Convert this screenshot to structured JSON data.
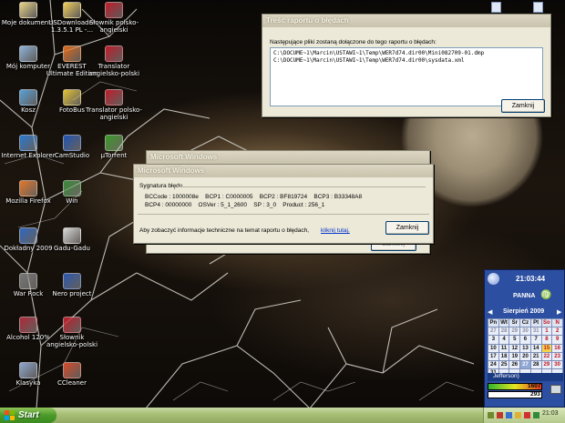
{
  "desktop_icons": [
    {
      "label": "Moje dokumenty",
      "icon": "my-documents-icon",
      "color": "#e8d48a"
    },
    {
      "label": "USDownloader 1.3.5.1 PL -...",
      "icon": "folder-icon",
      "color": "#f2cf5b"
    },
    {
      "label": "Słownik polsko-angielski",
      "icon": "dictionary-icon",
      "color": "#c01d2b"
    },
    {
      "label": "Mój komputer",
      "icon": "my-computer-icon",
      "color": "#8fb3d9"
    },
    {
      "label": "EVEREST Ultimate Edition",
      "icon": "everest-icon",
      "color": "#e06a1a"
    },
    {
      "label": "Translator angielsko-polski",
      "icon": "translator-icon",
      "color": "#c01d2b"
    },
    {
      "label": "Kosz",
      "icon": "recycle-bin-icon",
      "color": "#5aa2d8"
    },
    {
      "label": "FotoBus",
      "icon": "fotobus-icon",
      "color": "#e2c235"
    },
    {
      "label": "Translator polsko-angielski",
      "icon": "translator-icon",
      "color": "#c01d2b"
    },
    {
      "label": "Internet Explorer",
      "icon": "internet-explorer-icon",
      "color": "#2b78d0"
    },
    {
      "label": "CamStudio",
      "icon": "camstudio-icon",
      "color": "#2154b4"
    },
    {
      "label": "µTorrent",
      "icon": "utorrent-icon",
      "color": "#3a9b28"
    },
    {
      "label": "Mozilla Firefox",
      "icon": "firefox-icon",
      "color": "#e5772a"
    },
    {
      "label": "Win",
      "icon": "windows-shield-icon",
      "color": "#3b8b3a"
    },
    {
      "label": "Dokładny 2009",
      "icon": "app-icon",
      "color": "#2f68c2"
    },
    {
      "label": "Gadu-Gadu",
      "icon": "gadu-gadu-icon",
      "color": "#d8d8d8"
    },
    {
      "label": "War Rock",
      "icon": "war-rock-icon",
      "color": "#777777"
    },
    {
      "label": "Nero project",
      "icon": "nero-icon",
      "color": "#2c58b0"
    },
    {
      "label": "Alcohol 120%",
      "icon": "alcohol-icon",
      "color": "#b02a3a"
    },
    {
      "label": "Słownik angielsko-polski",
      "icon": "dictionary-icon",
      "color": "#c01d2b"
    },
    {
      "label": "Klasyka",
      "icon": "document-icon",
      "color": "#8fa7cf"
    },
    {
      "label": "CCleaner",
      "icon": "ccleaner-icon",
      "color": "#d84b2a"
    }
  ],
  "report_window": {
    "title": "Treść raportu o błędach",
    "intro": "Następujące pliki zostaną dołączone do tego raportu o błędach:",
    "files": [
      "C:\\DOCUME~1\\Marcin\\USTAWI~1\\Temp\\WER7d74.dir00\\Mini082709-01.dmp",
      "C:\\DOCUME~1\\Marcin\\USTAWI~1\\Temp\\WER7d74.dir00\\sysdata.xml"
    ],
    "close_label": "Zamknij"
  },
  "back_window": {
    "title": "Microsoft Windows",
    "close_label": "Zamknij"
  },
  "signature_window": {
    "title": "Microsoft Windows",
    "section_label": "Sygnatura błędu",
    "line1": "BCCode : 1000008e    BCP1 : C0000005    BCP2 : BF819724    BCP3 : B33348A8",
    "line2": "BCP4 : 00000000    OSVer : 5_1_2600    SP : 3_0    Product : 256_1",
    "info_text": "Aby zobaczyć informacje techniczne na temat raportu o błędach,",
    "link_text": "kliknij tutaj.",
    "close_label": "Zamknij"
  },
  "calendar_gadget": {
    "time": "21:03:44",
    "zodiac_name": "PANNA",
    "month_label": "Sierpień 2009",
    "weekdays": [
      "Pn",
      "Wt",
      "Śr",
      "Cz",
      "Pt",
      "So",
      "N"
    ],
    "weeks": [
      [
        "27",
        "28",
        "29",
        "30",
        "31",
        "1",
        "2"
      ],
      [
        "3",
        "4",
        "5",
        "6",
        "7",
        "8",
        "9"
      ],
      [
        "10",
        "11",
        "12",
        "13",
        "14",
        "15",
        "16"
      ],
      [
        "17",
        "18",
        "19",
        "20",
        "21",
        "22",
        "23"
      ],
      [
        "24",
        "25",
        "26",
        "27",
        "28",
        "29",
        "30"
      ],
      [
        "31",
        "",
        "",
        "",
        "",
        "",
        ""
      ]
    ],
    "today": "15",
    "selected": "27",
    "name_day": "Jefferson)",
    "counter_top": "1607",
    "counter_bottom": "293"
  },
  "taskbar": {
    "start_label": "Start",
    "clock": "21:03"
  },
  "colors": {
    "taskbar_green": "#a9c077",
    "start_green": "#4b9a2a",
    "window_face": "#ece9d8",
    "link_blue": "#0033cc",
    "gadget_blue": "#2d4fa1"
  }
}
